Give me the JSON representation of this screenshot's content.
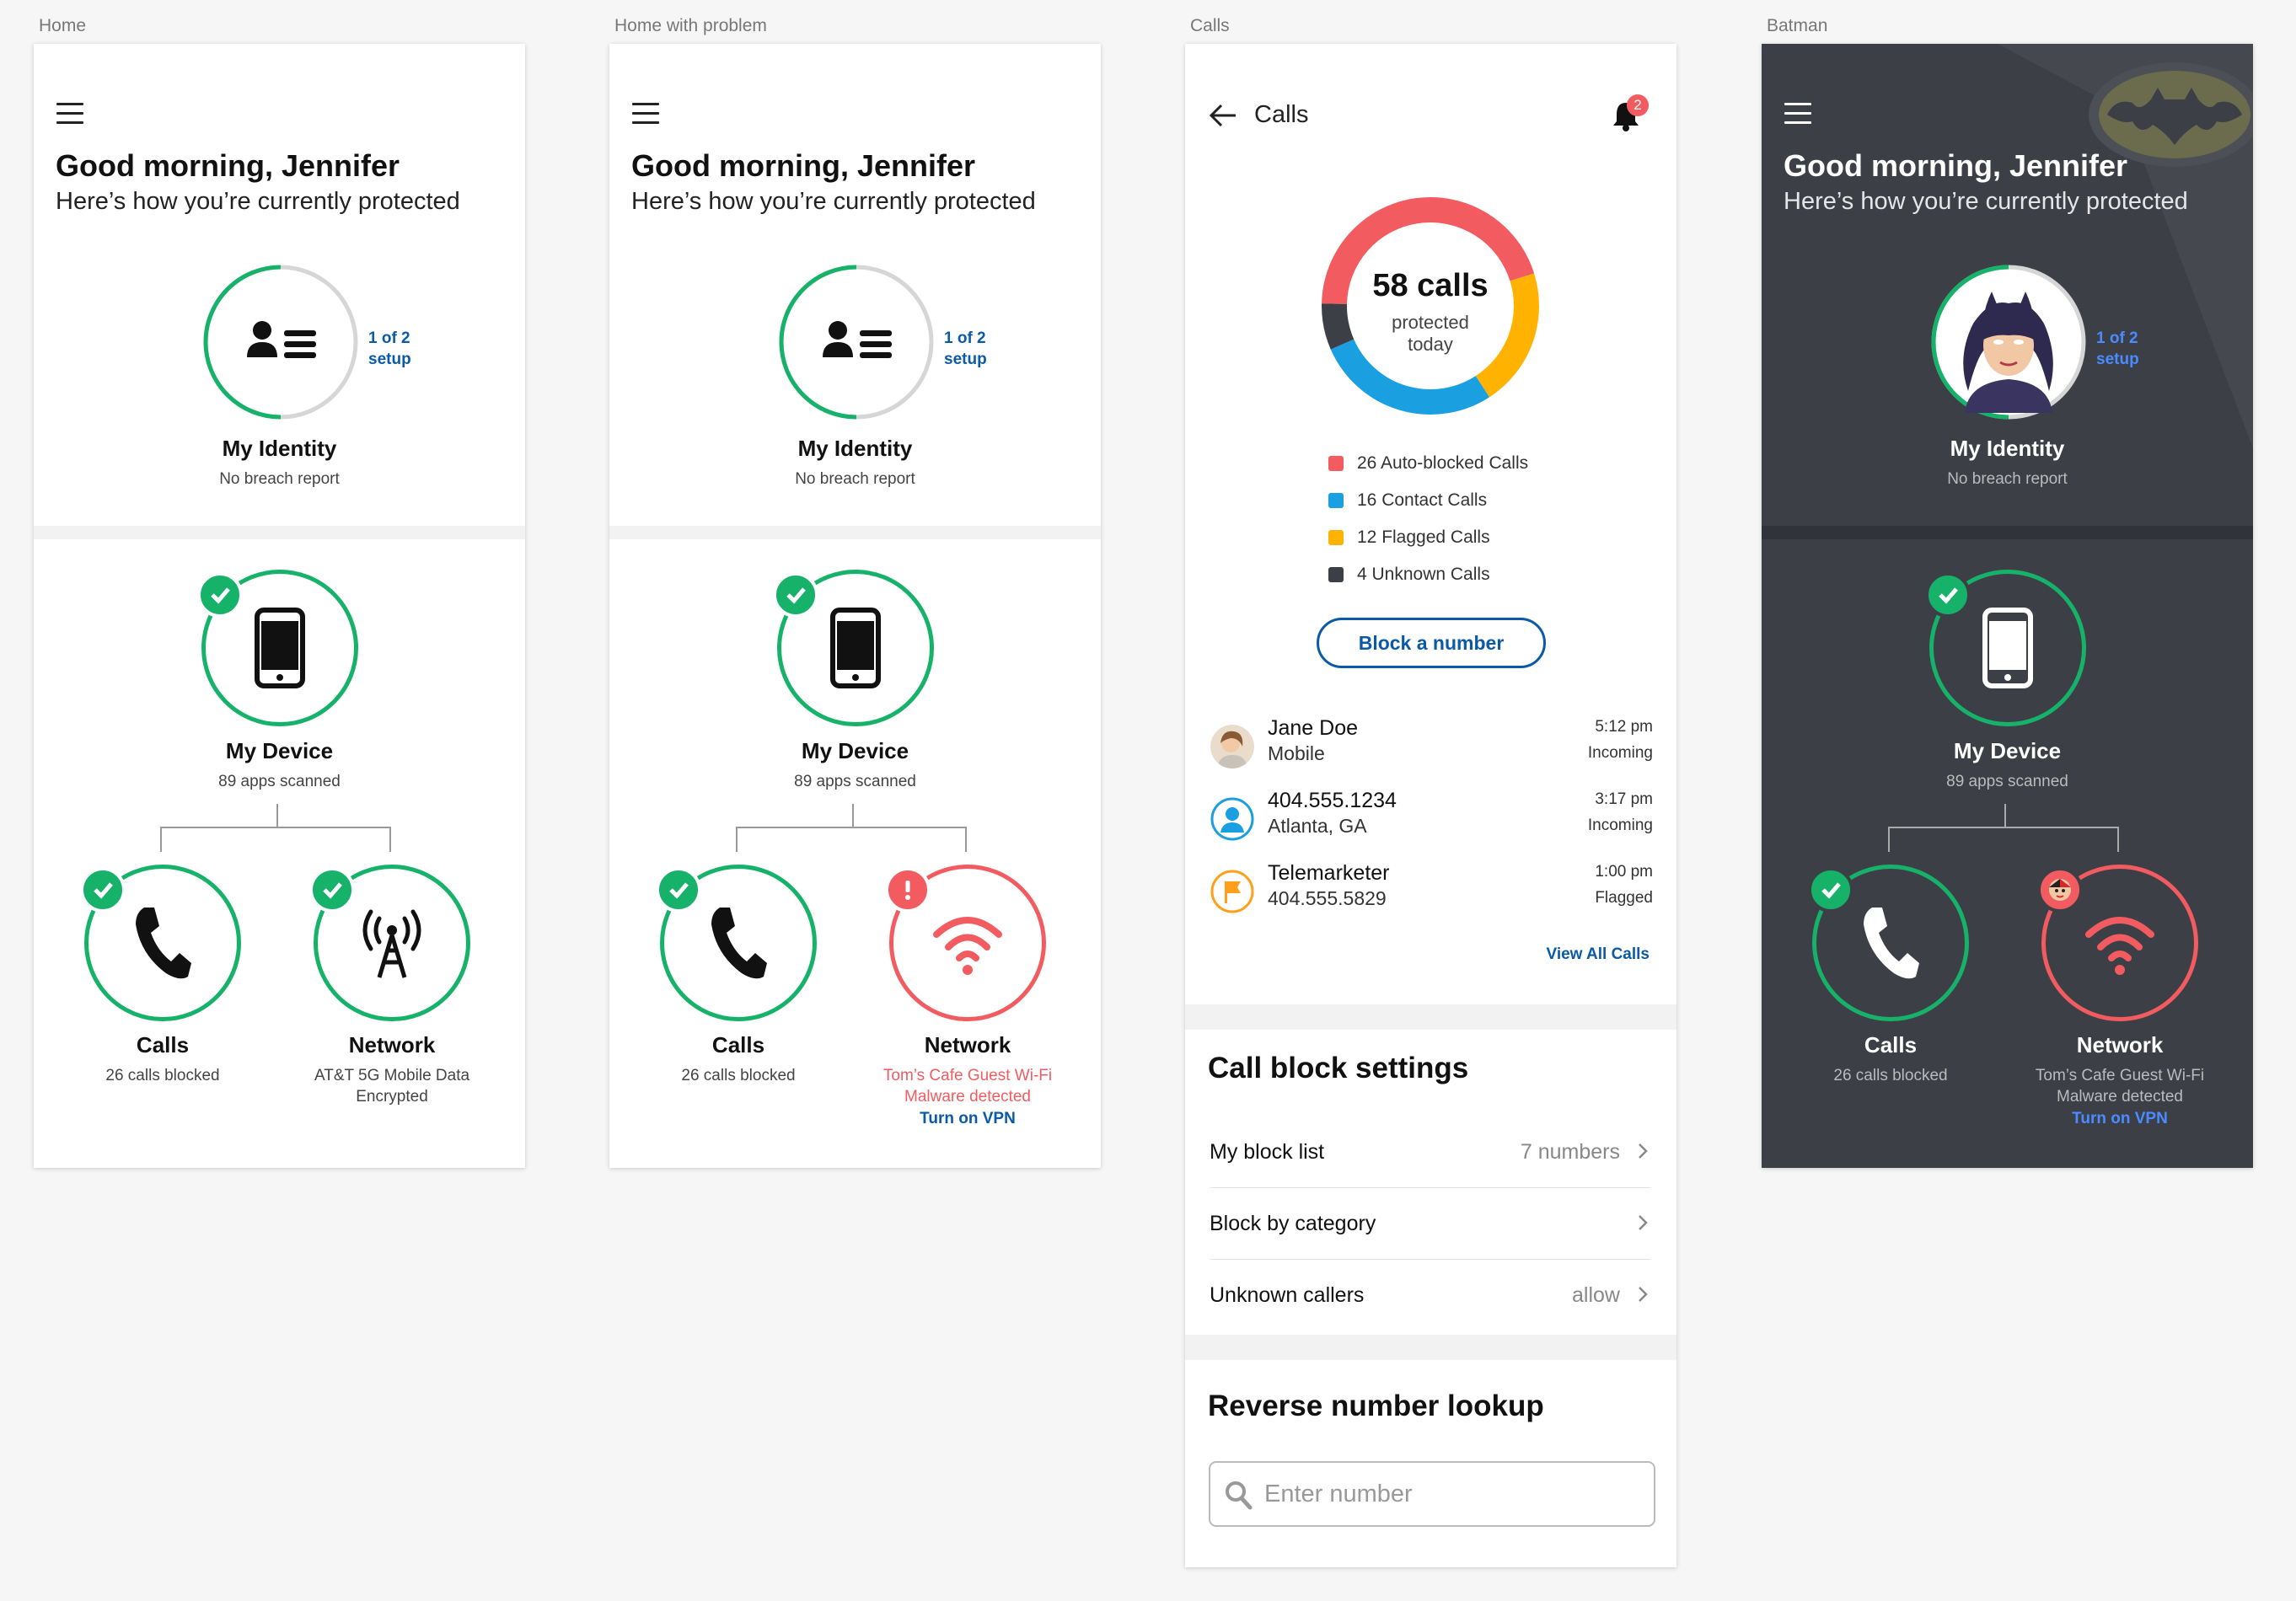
{
  "artboards": {
    "home": "Home",
    "home_problem": "Home with problem",
    "calls": "Calls",
    "batman": "Batman"
  },
  "home": {
    "greeting": "Good morning, Jennifer",
    "subtitle": "Here’s how you’re currently protected",
    "identity": {
      "title": "My Identity",
      "status": "No breach report",
      "setup_line1": "1 of 2",
      "setup_line2": "setup",
      "progress": 0.5
    },
    "device": {
      "title": "My Device",
      "status": "89 apps scanned"
    },
    "calls": {
      "title": "Calls",
      "status": "26 calls blocked"
    },
    "network": {
      "title": "Network",
      "status_line1": "AT&T 5G Mobile Data",
      "status_line2": "Encrypted"
    }
  },
  "problem": {
    "network": {
      "title": "Network",
      "line1": "Tom’s Cafe Guest Wi-Fi",
      "line2": "Malware detected",
      "action": "Turn on VPN"
    }
  },
  "calls_screen": {
    "title": "Calls",
    "notification_count": "2",
    "donut": {
      "count": "58 calls",
      "line1": "protected",
      "line2": "today"
    },
    "legend": [
      {
        "label": "26 Auto-blocked Calls",
        "color": "#f25c60",
        "value": 26
      },
      {
        "label": "16 Contact Calls",
        "color": "#1a9fe0",
        "value": 16
      },
      {
        "label": "12 Flagged Calls",
        "color": "#ffb300",
        "value": 12
      },
      {
        "label": "4 Unknown Calls",
        "color": "#3c3f46",
        "value": 4
      }
    ],
    "block_button": "Block a number",
    "recent": [
      {
        "name": "Jane Doe",
        "sub": "Mobile",
        "time": "5:12 pm",
        "type": "Incoming"
      },
      {
        "name": "404.555.1234",
        "sub": "Atlanta, GA",
        "time": "3:17 pm",
        "type": "Incoming"
      },
      {
        "name": "Telemarketer",
        "sub": "404.555.5829",
        "time": "1:00 pm",
        "type": "Flagged"
      }
    ],
    "view_all": "View All Calls",
    "settings_title": "Call block settings",
    "settings": [
      {
        "label": "My block list",
        "value": "7 numbers"
      },
      {
        "label": "Block by category",
        "value": ""
      },
      {
        "label": "Unknown callers",
        "value": "allow"
      }
    ],
    "lookup_title": "Reverse number lookup",
    "lookup_placeholder": "Enter number"
  },
  "colors": {
    "green": "#17b26a",
    "red": "#f25c60",
    "blue": "#0a5aa7",
    "dark": "#3c3f46"
  }
}
